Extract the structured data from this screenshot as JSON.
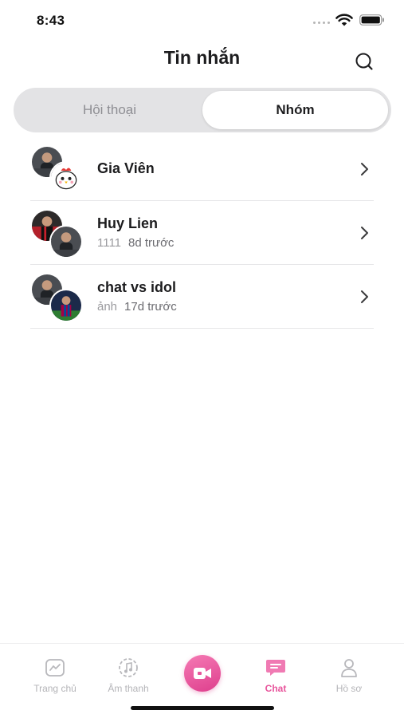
{
  "status_bar": {
    "time": "8:43"
  },
  "header": {
    "title": "Tin nhắn",
    "search_icon": "search-icon"
  },
  "segment": {
    "tabs": [
      {
        "label": "Hội thoại",
        "active": false
      },
      {
        "label": "Nhóm",
        "active": true
      }
    ]
  },
  "groups": [
    {
      "name": "Gia Viên",
      "preview": "",
      "time": ""
    },
    {
      "name": "Huy Lien",
      "preview": "1111",
      "time": "8d trước"
    },
    {
      "name": "chat vs idol",
      "preview": "ảnh",
      "time": "17d trước"
    }
  ],
  "tabbar": {
    "items": [
      {
        "label": "Trang chủ",
        "icon": "trend-icon"
      },
      {
        "label": "Âm thanh",
        "icon": "music-icon"
      },
      {
        "label": "",
        "icon": "video-camera-icon"
      },
      {
        "label": "Chat",
        "icon": "chat-icon",
        "active": true
      },
      {
        "label": "Hồ sơ",
        "icon": "profile-icon"
      }
    ]
  },
  "colors": {
    "accent": "#e8559c",
    "segment_bg": "#e3e3e5",
    "muted": "#9a9a9e"
  }
}
